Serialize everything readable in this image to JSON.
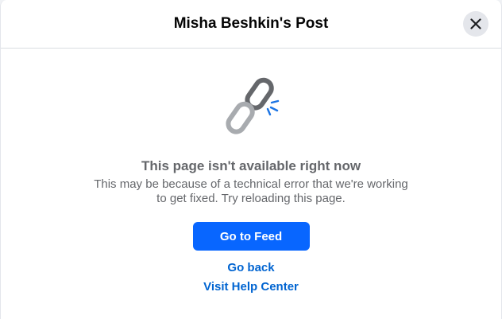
{
  "header": {
    "title": "Misha Beshkin's Post",
    "close_icon": "close-icon"
  },
  "error": {
    "icon": "broken-link-icon",
    "heading": "This page isn't available right now",
    "message_line1": "This may be because of a technical error that we're working",
    "message_line2": "to get fixed. Try reloading this page."
  },
  "actions": {
    "feed_button_label": "Go to Feed",
    "go_back_label": "Go back",
    "help_center_label": "Visit Help Center"
  },
  "colors": {
    "primary": "#0866ff",
    "link": "#0064d1",
    "muted_text": "#65676b",
    "icon_gray": "#8a8d91",
    "spark_blue": "#1b74e4"
  }
}
